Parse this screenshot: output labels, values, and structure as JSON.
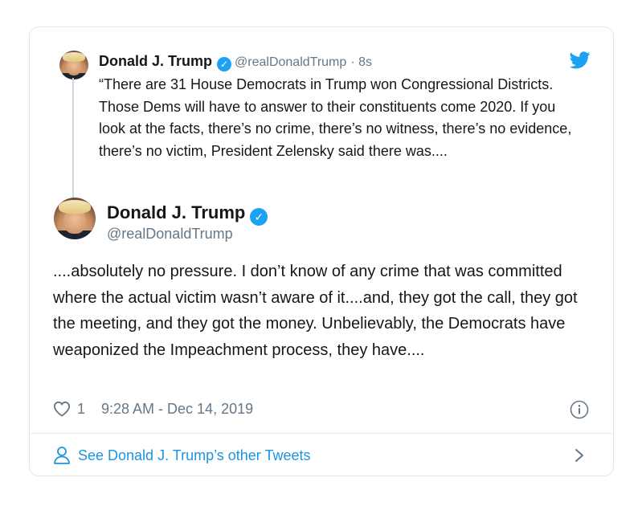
{
  "quoted_tweet": {
    "author_name": "Donald J. Trump",
    "author_handle": "@realDonaldTrump",
    "time_ago": "· 8s",
    "text": "“There are 31 House Democrats in Trump won Congressional Districts. Those Dems will have to answer to their constituents come 2020. If you look at the facts, there’s no crime, there’s no witness, there’s no evidence, there’s no victim, President Zelensky said there was...."
  },
  "main_tweet": {
    "author_name": "Donald J. Trump",
    "author_handle": "@realDonaldTrump",
    "text": "....absolutely no pressure. I don’t know of any crime that was committed where the actual victim wasn’t aware of it....and, they got the call, they got the meeting, and they got the money. Unbelievably, the Democrats have weaponized the Impeachment process, they have....",
    "like_count": "1",
    "timestamp": "9:28 AM - Dec 14, 2019"
  },
  "footer": {
    "see_other_label": "See Donald J. Trump’s other Tweets"
  },
  "icons": {
    "verified": "verified-badge-icon",
    "bird": "twitter-bird-icon",
    "heart": "heart-icon",
    "info": "info-icon",
    "person": "person-icon",
    "chevron": "chevron-right-icon"
  },
  "colors": {
    "accent": "#1da1f2",
    "link": "#1b95e0",
    "muted": "#657786",
    "border": "#e1e8ed"
  }
}
